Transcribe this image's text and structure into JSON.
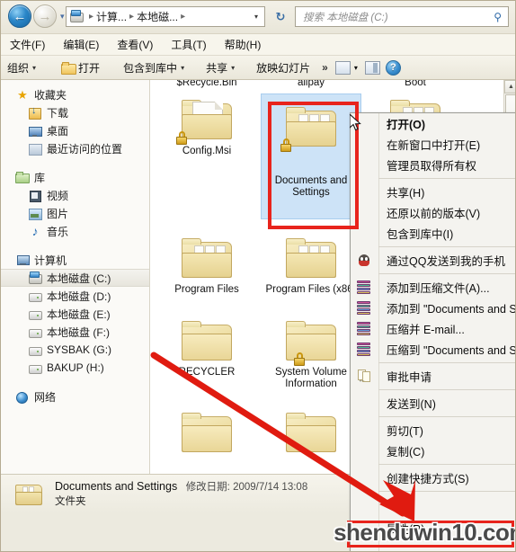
{
  "window": {
    "address": {
      "crumbs": [
        "计算...",
        "本地磁..."
      ],
      "drive_icon": "local-disk-icon",
      "back_label": "←",
      "forward_label": "→",
      "history_caret": "▾",
      "path_caret": "▾",
      "refresh_label": "↻"
    },
    "search": {
      "placeholder": "搜索 本地磁盘 (C:)",
      "icon": "search-icon"
    }
  },
  "menubar": {
    "items": [
      "文件(F)",
      "编辑(E)",
      "查看(V)",
      "工具(T)",
      "帮助(H)"
    ]
  },
  "toolbar": {
    "organize": "组织",
    "open": "打开",
    "include_in_library": "包含到库中",
    "share": "共享",
    "slideshow": "放映幻灯片",
    "overflow": "»",
    "caret": "▾",
    "preview_pane_icon": "preview-pane-icon",
    "layout_icon": "layout-pane-icon",
    "help_icon": "help-icon",
    "help_glyph": "?"
  },
  "sidebar": {
    "groups": [
      {
        "header": {
          "label": "收藏夹",
          "icon": "star-icon"
        },
        "items": [
          {
            "label": "下载",
            "icon": "downloads-icon"
          },
          {
            "label": "桌面",
            "icon": "desktop-icon"
          },
          {
            "label": "最近访问的位置",
            "icon": "recent-places-icon"
          }
        ]
      },
      {
        "header": {
          "label": "库",
          "icon": "library-icon"
        },
        "items": [
          {
            "label": "视频",
            "icon": "videos-icon"
          },
          {
            "label": "图片",
            "icon": "pictures-icon"
          },
          {
            "label": "音乐",
            "icon": "music-icon"
          }
        ]
      },
      {
        "header": {
          "label": "计算机",
          "icon": "computer-icon"
        },
        "items": [
          {
            "label": "本地磁盘 (C:)",
            "icon": "system-drive-icon",
            "selected": true
          },
          {
            "label": "本地磁盘 (D:)",
            "icon": "drive-icon"
          },
          {
            "label": "本地磁盘 (E:)",
            "icon": "drive-icon"
          },
          {
            "label": "本地磁盘 (F:)",
            "icon": "drive-icon"
          },
          {
            "label": "SYSBAK (G:)",
            "icon": "drive-icon"
          },
          {
            "label": "BAKUP (H:)",
            "icon": "drive-icon"
          }
        ]
      },
      {
        "header": {
          "label": "网络",
          "icon": "network-icon"
        },
        "items": []
      }
    ]
  },
  "files": [
    {
      "name": "$Recycle.Bin",
      "icon": "folder",
      "locked": false,
      "row": 0,
      "col": 0,
      "partial_top": true
    },
    {
      "name": "alipay",
      "icon": "folder",
      "locked": false,
      "row": 0,
      "col": 1,
      "partial_top": true
    },
    {
      "name": "Boot",
      "icon": "folder",
      "locked": false,
      "row": 0,
      "col": 2,
      "partial_top": true
    },
    {
      "name": "Config.Msi",
      "icon": "folder-doc",
      "locked": true,
      "row": 1,
      "col": 0
    },
    {
      "name": "Documents and Settings",
      "icon": "folder",
      "locked": true,
      "row": 1,
      "col": 1,
      "selected": true
    },
    {
      "name": "",
      "icon": "folder",
      "locked": false,
      "row": 1,
      "col": 2
    },
    {
      "name": "Program Files",
      "icon": "folder",
      "locked": false,
      "row": 2,
      "col": 0
    },
    {
      "name": "Program Files (x86)",
      "icon": "folder",
      "locked": false,
      "row": 2,
      "col": 1
    },
    {
      "name": "RECYCLER",
      "icon": "folder-plain",
      "locked": false,
      "row": 3,
      "col": 0
    },
    {
      "name": "System Volume Information",
      "icon": "folder-plain",
      "locked": true,
      "row": 3,
      "col": 1
    }
  ],
  "context_menu": {
    "items": [
      {
        "label": "打开(O)",
        "bold": true,
        "icon": ""
      },
      {
        "label": "在新窗口中打开(E)",
        "icon": ""
      },
      {
        "label": "管理员取得所有权",
        "icon": ""
      },
      {
        "separator": true
      },
      {
        "label": "共享(H)",
        "icon": ""
      },
      {
        "label": "还原以前的版本(V)",
        "icon": ""
      },
      {
        "label": "包含到库中(I)",
        "icon": ""
      },
      {
        "separator": true
      },
      {
        "label": "通过QQ发送到我的手机",
        "icon": "qq-icon"
      },
      {
        "separator": true
      },
      {
        "label": "添加到压缩文件(A)...",
        "icon": "winrar-icon"
      },
      {
        "label": "添加到 \"Documents and S",
        "icon": "winrar-icon"
      },
      {
        "label": "压缩并 E-mail...",
        "icon": "winrar-icon"
      },
      {
        "label": "压缩到 \"Documents and S",
        "icon": "winrar-icon"
      },
      {
        "separator": true
      },
      {
        "label": "审批申请",
        "icon": "approval-icon"
      },
      {
        "separator": true
      },
      {
        "label": "发送到(N)",
        "icon": ""
      },
      {
        "separator": true
      },
      {
        "label": "剪切(T)",
        "icon": ""
      },
      {
        "label": "复制(C)",
        "icon": ""
      },
      {
        "separator": true
      },
      {
        "label": "创建快捷方式(S)",
        "icon": ""
      },
      {
        "separator": true
      },
      {
        "label": "属性(R)",
        "icon": ""
      }
    ]
  },
  "status_bar": {
    "name": "Documents and Settings",
    "modified_label": "修改日期: 2009/7/14 13:08",
    "type": "文件夹",
    "icon": "folder-icon"
  },
  "annotations": {
    "watermark": "shenduwin10.com",
    "highlight_color": "#e8241c",
    "arrow_color": "#e01b10"
  },
  "scrollbar": {
    "up": "▲",
    "down": "▼"
  }
}
